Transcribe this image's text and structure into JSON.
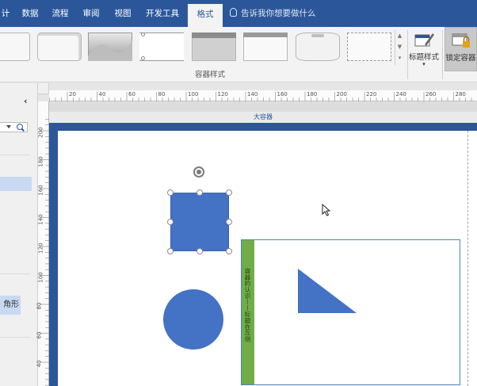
{
  "tabs": [
    {
      "label": "计",
      "active": false
    },
    {
      "label": "数据",
      "active": false
    },
    {
      "label": "流程",
      "active": false
    },
    {
      "label": "审阅",
      "active": false
    },
    {
      "label": "视图",
      "active": false
    },
    {
      "label": "开发工具",
      "active": false
    },
    {
      "label": "格式",
      "active": true
    }
  ],
  "tell_me": {
    "placeholder": "告诉我你想要做什么"
  },
  "ribbon": {
    "group_label": "容器样式",
    "title_style_label": "标题样式",
    "lock_container_label": "锁定容器"
  },
  "left_panel": {
    "collapse_glyph": "‹",
    "item_label": "角形"
  },
  "ruler": {
    "h_ticks": [
      "20",
      "40",
      "60",
      "80",
      "100",
      "120",
      "140",
      "160",
      "180",
      "200",
      "220",
      "240",
      "260",
      "280"
    ],
    "v_ticks": [
      "200",
      "180",
      "160",
      "140",
      "120",
      "100",
      "80",
      "60",
      "40"
    ]
  },
  "canvas": {
    "outer_container_title": "大容器",
    "inner_container_title": "容器的认识——标题在左侧"
  },
  "colors": {
    "brand": "#2b579a",
    "shape_fill": "#4472c4",
    "heading_bar": "#70ad47"
  }
}
